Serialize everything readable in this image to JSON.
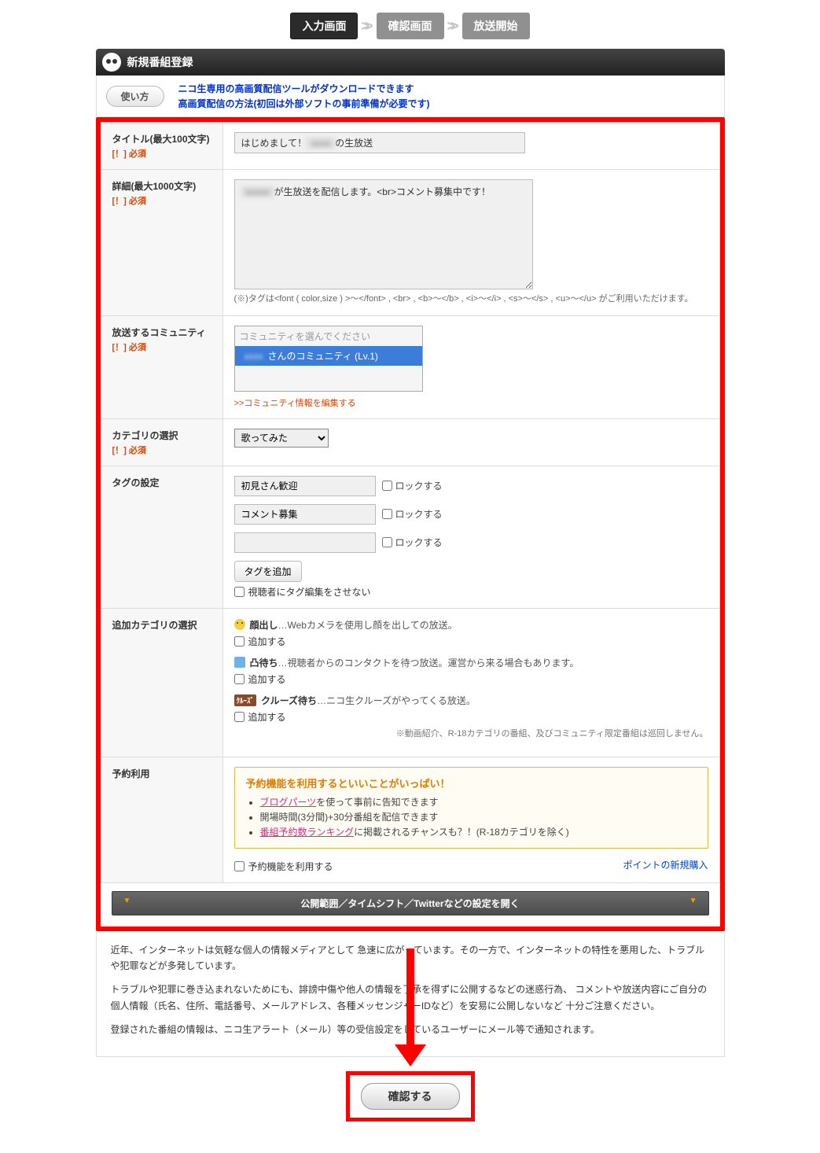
{
  "steps": {
    "input": "入力画面",
    "confirm": "確認画面",
    "start": "放送開始"
  },
  "header": {
    "title": "新規番組登録"
  },
  "help": {
    "usage_button": "使い方",
    "link1": "ニコ生専用の高画質配信ツールがダウンロードできます",
    "link2": "高画質配信の方法(初回は外部ソフトの事前準備が必要です)"
  },
  "fields": {
    "required_label": "[！] 必須",
    "title": {
      "label": "タイトル(最大100文字)",
      "value_prefix": "はじめまして！",
      "value_suffix": "の生放送"
    },
    "detail": {
      "label": "詳細(最大1000文字)",
      "value_suffix": "が生放送を配信します。<br>コメント募集中です！",
      "hint": "(※)タグは<font ( color,size ) >～</font> ,  <br> ,  <b>～</b> ,  <i>～</i> ,  <s>～</s> ,  <u>～</u> がご利用いただけます。"
    },
    "community": {
      "label": "放送するコミュニティ",
      "placeholder_option": "コミュニティを選んでください",
      "selected_option_suffix": "さんのコミュニティ (Lv.1)",
      "edit_link": ">>コミュニティ情報を編集する"
    },
    "category": {
      "label": "カテゴリの選択",
      "selected": "歌ってみた"
    },
    "tags": {
      "label": "タグの設定",
      "lock_label": "ロックする",
      "items": [
        "初見さん歓迎",
        "コメント募集",
        ""
      ],
      "add_button": "タグを追加",
      "viewer_edit_label": "視聴者にタグ編集をさせない"
    },
    "addcat": {
      "label": "追加カテゴリの選択",
      "add_label": "追加する",
      "items": [
        {
          "icon": "face",
          "name": "顔出し",
          "desc": "…Webカメラを使用し顔を出しての放送。"
        },
        {
          "icon": "phone",
          "name": "凸待ち",
          "desc": "…視聴者からのコンタクトを待つ放送。運営から来る場合もあります。"
        },
        {
          "icon": "cruise",
          "badge": "ｸﾙｰｽﾞ",
          "name": "クルーズ待ち",
          "desc": "…ニコ生クルーズがやってくる放送。"
        }
      ],
      "note": "※動画紹介、R-18カテゴリの番組、及びコミュニティ限定番組は巡回しません。"
    },
    "reservation": {
      "label": "予約利用",
      "box_title": "予約機能を利用するといいことがいっぱい！",
      "bullets": [
        {
          "link": "ブログパーツ",
          "text": "を使って事前に告知できます"
        },
        {
          "text": "開場時間(3分間)+30分番組を配信できます"
        },
        {
          "link": "番組予約数ランキング",
          "text": "に掲載されるチャンスも？！(R-18カテゴリを除く)"
        }
      ],
      "use_label": "予約機能を利用する",
      "point_link": "ポイントの新規購入"
    }
  },
  "expand_bar": "公開範囲／タイムシフト／Twitterなどの設定を開く",
  "disclaimer": {
    "p1": "近年、インターネットは気軽な個人の情報メディアとして 急速に広がっています。その一方で、インターネットの特性を悪用した、トラブルや犯罪などが多発しています。",
    "p2": "トラブルや犯罪に巻き込まれないためにも、誹謗中傷や他人の情報を了承を得ずに公開するなどの迷惑行為、 コメントや放送内容にご自分の個人情報（氏名、住所、電話番号、メールアドレス、各種メッセンジャーIDなど）を安易に公開しないなど 十分ご注意ください。",
    "p3": "登録された番組の情報は、ニコ生アラート（メール）等の受信設定をしているユーザーにメール等で通知されます。"
  },
  "confirm_button": "確認する"
}
